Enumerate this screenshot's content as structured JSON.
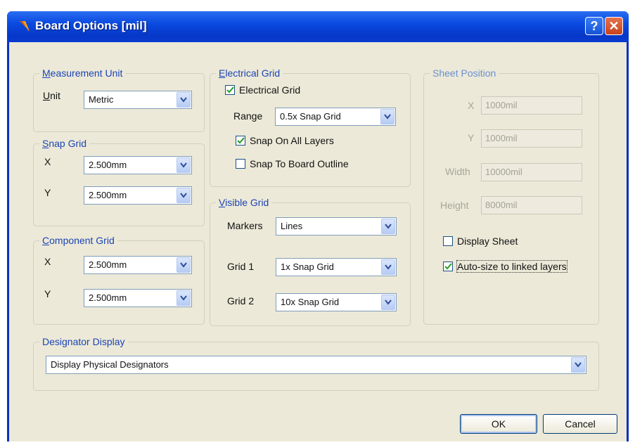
{
  "window": {
    "title": "Board Options [mil]",
    "help_label": "?",
    "close_label": "✕"
  },
  "measurement_unit": {
    "legend_u": "M",
    "legend_rest": "easurement Unit",
    "unit_label_u": "U",
    "unit_label_rest": "nit",
    "unit_value": "Metric"
  },
  "snap_grid": {
    "legend_u": "S",
    "legend_rest": "nap Grid",
    "x_label": "X",
    "x_value": "2.500mm",
    "y_label": "Y",
    "y_value": "2.500mm"
  },
  "component_grid": {
    "legend_u": "C",
    "legend_rest": "omponent Grid",
    "x_label": "X",
    "x_value": "2.500mm",
    "y_label": "Y",
    "y_value": "2.500mm"
  },
  "electrical_grid": {
    "legend_u": "E",
    "legend_rest": "lectrical Grid",
    "electrical_grid_label": "Electrical Grid",
    "electrical_grid_checked": true,
    "range_label": "Range",
    "range_value": "0.5x Snap Grid",
    "snap_all_layers_label": "Snap On All Layers",
    "snap_all_layers_checked": true,
    "snap_board_outline_label": "Snap To Board Outline",
    "snap_board_outline_checked": false
  },
  "visible_grid": {
    "legend_u": "V",
    "legend_rest": "isible Grid",
    "markers_label": "Markers",
    "markers_value": "Lines",
    "grid1_label": "Grid 1",
    "grid1_value": "1x Snap Grid",
    "grid2_label": "Grid 2",
    "grid2_value": "10x Snap Grid"
  },
  "sheet_position": {
    "legend": "Sheet Position",
    "x_label": "X",
    "x_value": "1000mil",
    "y_label": "Y",
    "y_value": "1000mil",
    "width_label": "Width",
    "width_value": "10000mil",
    "height_label": "Height",
    "height_value": "8000mil",
    "display_sheet_label": "Display Sheet",
    "display_sheet_checked": false,
    "auto_size_label": "Auto-size to linked layers",
    "auto_size_checked": true
  },
  "designator_display": {
    "legend": "Designator Display",
    "value": "Display Physical Designators"
  },
  "buttons": {
    "ok": "OK",
    "cancel": "Cancel"
  },
  "colors": {
    "title_bar": "#0a4ae0",
    "dialog_bg": "#ece9d8",
    "legend_text": "#1c44b5",
    "check_mark": "#21a121"
  }
}
